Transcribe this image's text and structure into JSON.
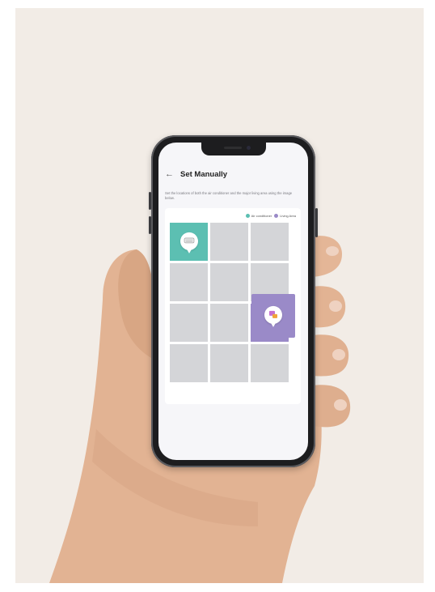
{
  "screen": {
    "title": "Set Manually",
    "back_icon": "back-arrow-icon",
    "description": "Set the locations of both the air conditioner and the major living area using the image below.",
    "legend": {
      "ac_label": "Air conditioner",
      "ac_color": "#5cbfb2",
      "living_label": "Living Area",
      "living_color": "#9a8ac8"
    },
    "grid": {
      "rows": 4,
      "cols": 3,
      "ac_cell": "row 1, column 1",
      "living_cell": "row 3, column 3"
    }
  },
  "colors": {
    "background": "#f2ece6",
    "phone_frame": "#1d1d1f",
    "grid_cell": "#d4d5d8"
  }
}
